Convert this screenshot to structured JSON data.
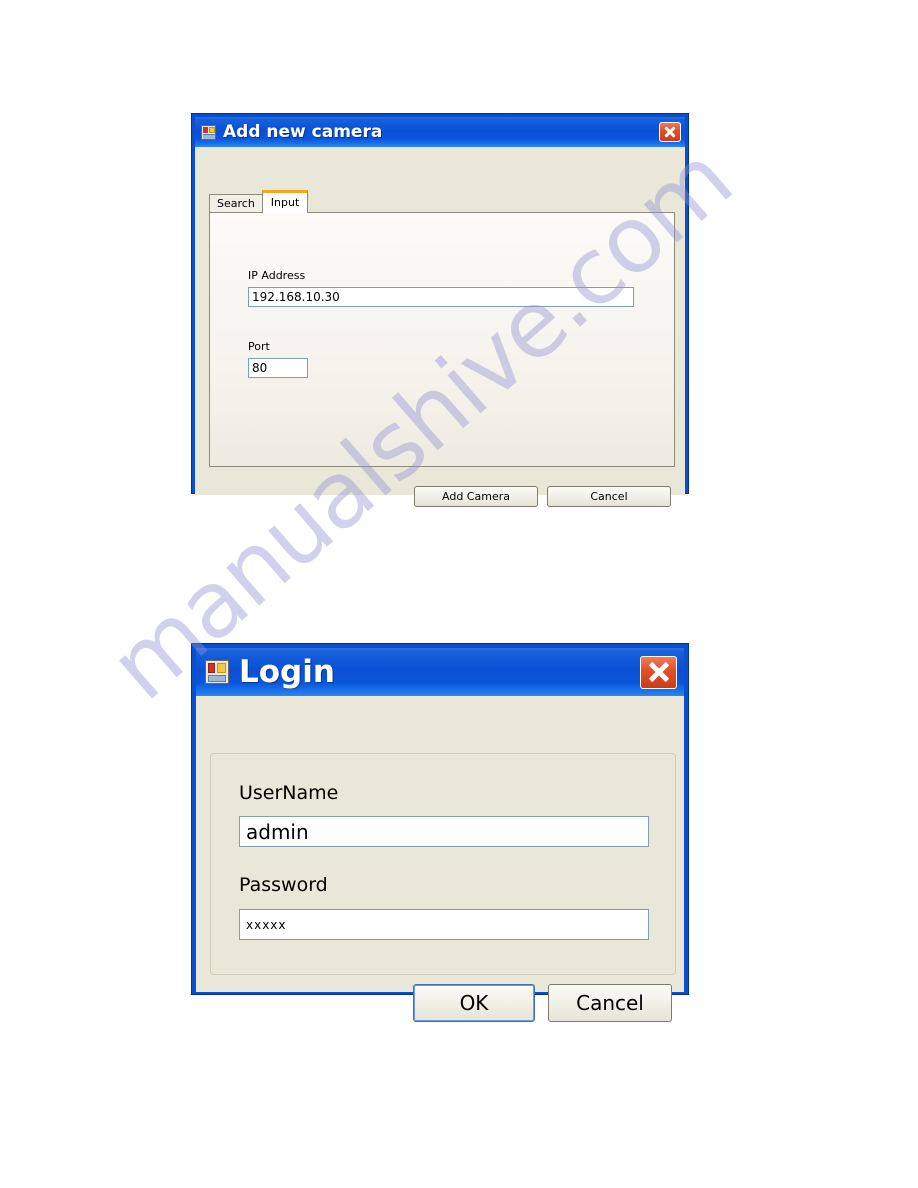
{
  "page": {
    "watermark_text": "manualshive.com",
    "background_color": "#ffffff",
    "watermark_color": "#8f8fd4"
  },
  "theme": {
    "titlebar_blue": "#0A50D4",
    "dialog_beige": "#e9e7d8",
    "tab_active_accent": "#f0a81e",
    "close_button_red": "#e2502a",
    "textbox_border": "#7f9db9"
  },
  "add_camera_dialog": {
    "title": "Add new camera",
    "window_icon": "form-icon",
    "close_button": "close-icon",
    "tabs": [
      {
        "label": "Search",
        "active": false
      },
      {
        "label": "Input",
        "active": true
      }
    ],
    "fields": [
      {
        "label": "IP Address",
        "value": "192.168.10.30",
        "placeholder": ""
      },
      {
        "label": "Port",
        "value": "80",
        "placeholder": ""
      }
    ],
    "buttons": [
      {
        "label": "Add Camera",
        "default": false
      },
      {
        "label": "Cancel",
        "default": false
      }
    ]
  },
  "login_dialog": {
    "title": "Login",
    "window_icon": "form-icon",
    "close_button": "close-icon",
    "fields": [
      {
        "label": "UserName",
        "value": "admin",
        "placeholder": ""
      },
      {
        "label": "Password",
        "value": "xxxxx",
        "placeholder": ""
      }
    ],
    "buttons": [
      {
        "label": "OK",
        "default": true
      },
      {
        "label": "Cancel",
        "default": false
      }
    ]
  }
}
